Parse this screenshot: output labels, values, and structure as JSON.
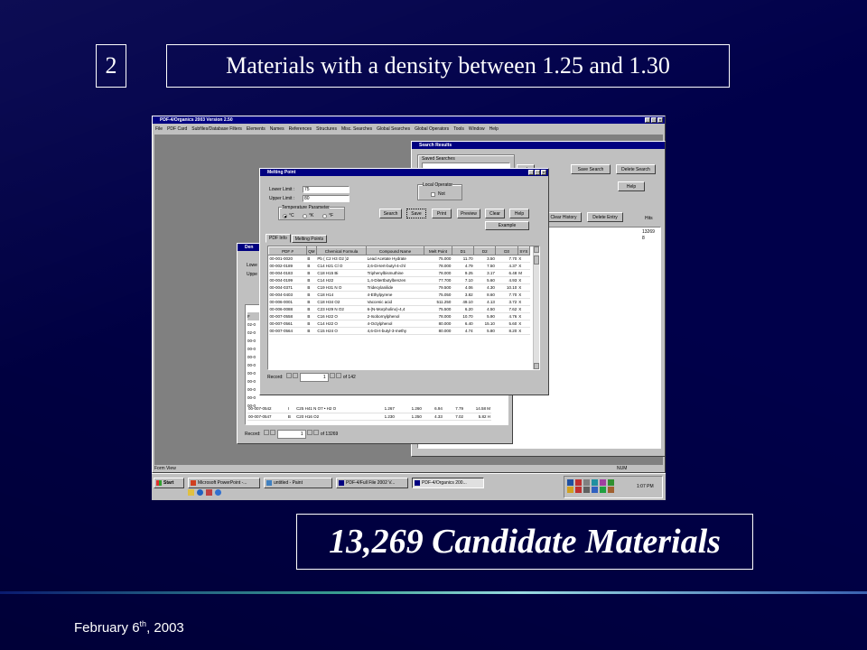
{
  "slide": {
    "number": "2",
    "title": "Materials with a density between 1.25 and 1.30",
    "candidates": "13,269 Candidate Materials",
    "date_main": "February 6",
    "date_sup": "th",
    "date_tail": ", 2003"
  },
  "app": {
    "title": "PDF-4/Organics 2003 Version 2.50",
    "menu": [
      "File",
      "PDF Card",
      "Subfiles/Database Filters",
      "Elements",
      "Names",
      "References",
      "Structures",
      "Misc. Searches",
      "Global Searches",
      "Global Operators",
      "Tools",
      "Window",
      "Help"
    ],
    "status_left": "Form View",
    "status_right": "NUM"
  },
  "search_results": {
    "title": "Search Results",
    "saved_label": "Saved Searches",
    "buttons": {
      "search": "rch",
      "save_search": "Save Search",
      "delete_search": "Delete Search",
      "results": "sults",
      "help": "Help",
      "clear_history": "Clear History",
      "delete_entry": "Delete Entry"
    },
    "hits_label": "Hits",
    "hits": [
      "13269",
      "8"
    ]
  },
  "back_window": {
    "title": "Den",
    "lower_label": "Lowe",
    "upper_label": "Uppe",
    "col_label": "F",
    "left_rows": [
      "02-0",
      "02-0",
      "00-0",
      "00-0",
      "00-0",
      "00-0",
      "00-0",
      "00-0",
      "00-0",
      "00-0",
      "00-0"
    ],
    "rows": [
      {
        "pdf": "00-007-0542",
        "qm": "I",
        "formula": "C25 H41 N O7 • H2 O",
        "a": "1.267",
        "b": "1.260",
        "c": "6.94",
        "d": "7.79",
        "e": "14.58 M"
      },
      {
        "pdf": "00-007-0547",
        "qm": "B",
        "formula": "C20 H16 O2",
        "a": "1.230",
        "b": "1.250",
        "c": "4.33",
        "d": "7.02",
        "e": "5.82 H"
      }
    ],
    "record_label": "Record:",
    "record_value": "1",
    "record_of": "of  13269"
  },
  "melting_point": {
    "title": "Melting Point",
    "lower_label": "Lower Limit :",
    "lower_value": "75",
    "upper_label": "Upper Limit :",
    "upper_value": "80",
    "local_operator_label": "Local Operator",
    "not_label": "Not",
    "temp_label": "Temperature Parameter",
    "temp_options": [
      "°C",
      "°K",
      "°F"
    ],
    "buttons": {
      "search": "Search",
      "save": "Save",
      "print": "Print",
      "preview": "Preview",
      "clear": "Clear",
      "help": "Help",
      "example": "Example"
    },
    "tabs": [
      "PDF Info",
      "Melting Points"
    ],
    "columns": [
      "PDF #",
      "QM",
      "Chemical Formula",
      "Compound Name",
      "Melt Point",
      "D1",
      "D2",
      "D3",
      "SYS"
    ],
    "rows": [
      {
        "pdf": "00-001-0020",
        "qm": "B",
        "formula": "Pb ( C2 H3 O2 )2",
        "name": "Lead Acetate Hydrate",
        "melt": "75.000",
        "d1": "11.70",
        "d2": "3.50",
        "d3": "7.70",
        "sys": "X"
      },
      {
        "pdf": "00-002-0189",
        "qm": "B",
        "formula": "C14 H21 Cl O",
        "name": "2,6-Di-tert-butyl-4-chl",
        "melt": "78.000",
        "d1": "4.79",
        "d2": "7.50",
        "d3": "4.37",
        "sys": "X"
      },
      {
        "pdf": "00-004-0183",
        "qm": "B",
        "formula": "C18 H15 Bi",
        "name": "Triphenylbismuthine",
        "melt": "78.000",
        "d1": "9.25",
        "d2": "3.17",
        "d3": "6.48",
        "sys": "M"
      },
      {
        "pdf": "00-004-0199",
        "qm": "B",
        "formula": "C14 H22",
        "name": "1,4-Ditertbutylbenzen",
        "melt": "77.700",
        "d1": "7.10",
        "d2": "5.60",
        "d3": "4.93",
        "sys": "X"
      },
      {
        "pdf": "00-004-0371",
        "qm": "B",
        "formula": "C19 H31 N O",
        "name": "Tridecylanilide",
        "melt": "79.500",
        "d1": "4.06",
        "d2": "4.30",
        "d3": "10.10",
        "sys": "X"
      },
      {
        "pdf": "00-004-0403",
        "qm": "B",
        "formula": "C18 H14",
        "name": "4-Ethylpyrene",
        "melt": "75.050",
        "d1": "3.82",
        "d2": "8.60",
        "d3": "7.70",
        "sys": "X"
      },
      {
        "pdf": "00-006-0001",
        "qm": "B",
        "formula": "C18 H34 O2",
        "name": "Vaccenic acid",
        "melt": "511.250",
        "d1": "49.10",
        "d2": "4.13",
        "d3": "3.72",
        "sys": "X"
      },
      {
        "pdf": "00-006-0088",
        "qm": "B",
        "formula": "C23 H29 N O2",
        "name": "6-(N-Morpholino)-4,4",
        "melt": "75.500",
        "d1": "6.20",
        "d2": "4.50",
        "d3": "7.62",
        "sys": "X"
      },
      {
        "pdf": "00-007-0558",
        "qm": "B",
        "formula": "C16 H22 O",
        "name": "2-Isobornylphenol",
        "melt": "78.000",
        "d1": "10.70",
        "d2": "5.90",
        "d3": "4.76",
        "sys": "X"
      },
      {
        "pdf": "00-007-0561",
        "qm": "B",
        "formula": "C14 H22 O",
        "name": "4-Octylphenol",
        "melt": "80.000",
        "d1": "6.40",
        "d2": "15.10",
        "d3": "5.60",
        "sys": "X"
      },
      {
        "pdf": "00-007-0564",
        "qm": "B",
        "formula": "C15 H24 O",
        "name": "4,6-Di-t-butyl-3-methy",
        "melt": "80.000",
        "d1": "4.74",
        "d2": "5.80",
        "d3": "8.20",
        "sys": "X"
      }
    ],
    "record_label": "Record:",
    "record_value": "1",
    "record_of": "of  142"
  },
  "taskbar": {
    "start": "Start",
    "items": [
      "Microsoft PowerPoint -...",
      "untitled - Paint",
      "PDF-4/Full File 2002 V...",
      "PDF-4/Organics 200..."
    ],
    "clock": "1:07 PM"
  },
  "colors": {
    "slide_bg": "#00004a",
    "titlebar": "#000080",
    "window_face": "#c0c0c0"
  }
}
